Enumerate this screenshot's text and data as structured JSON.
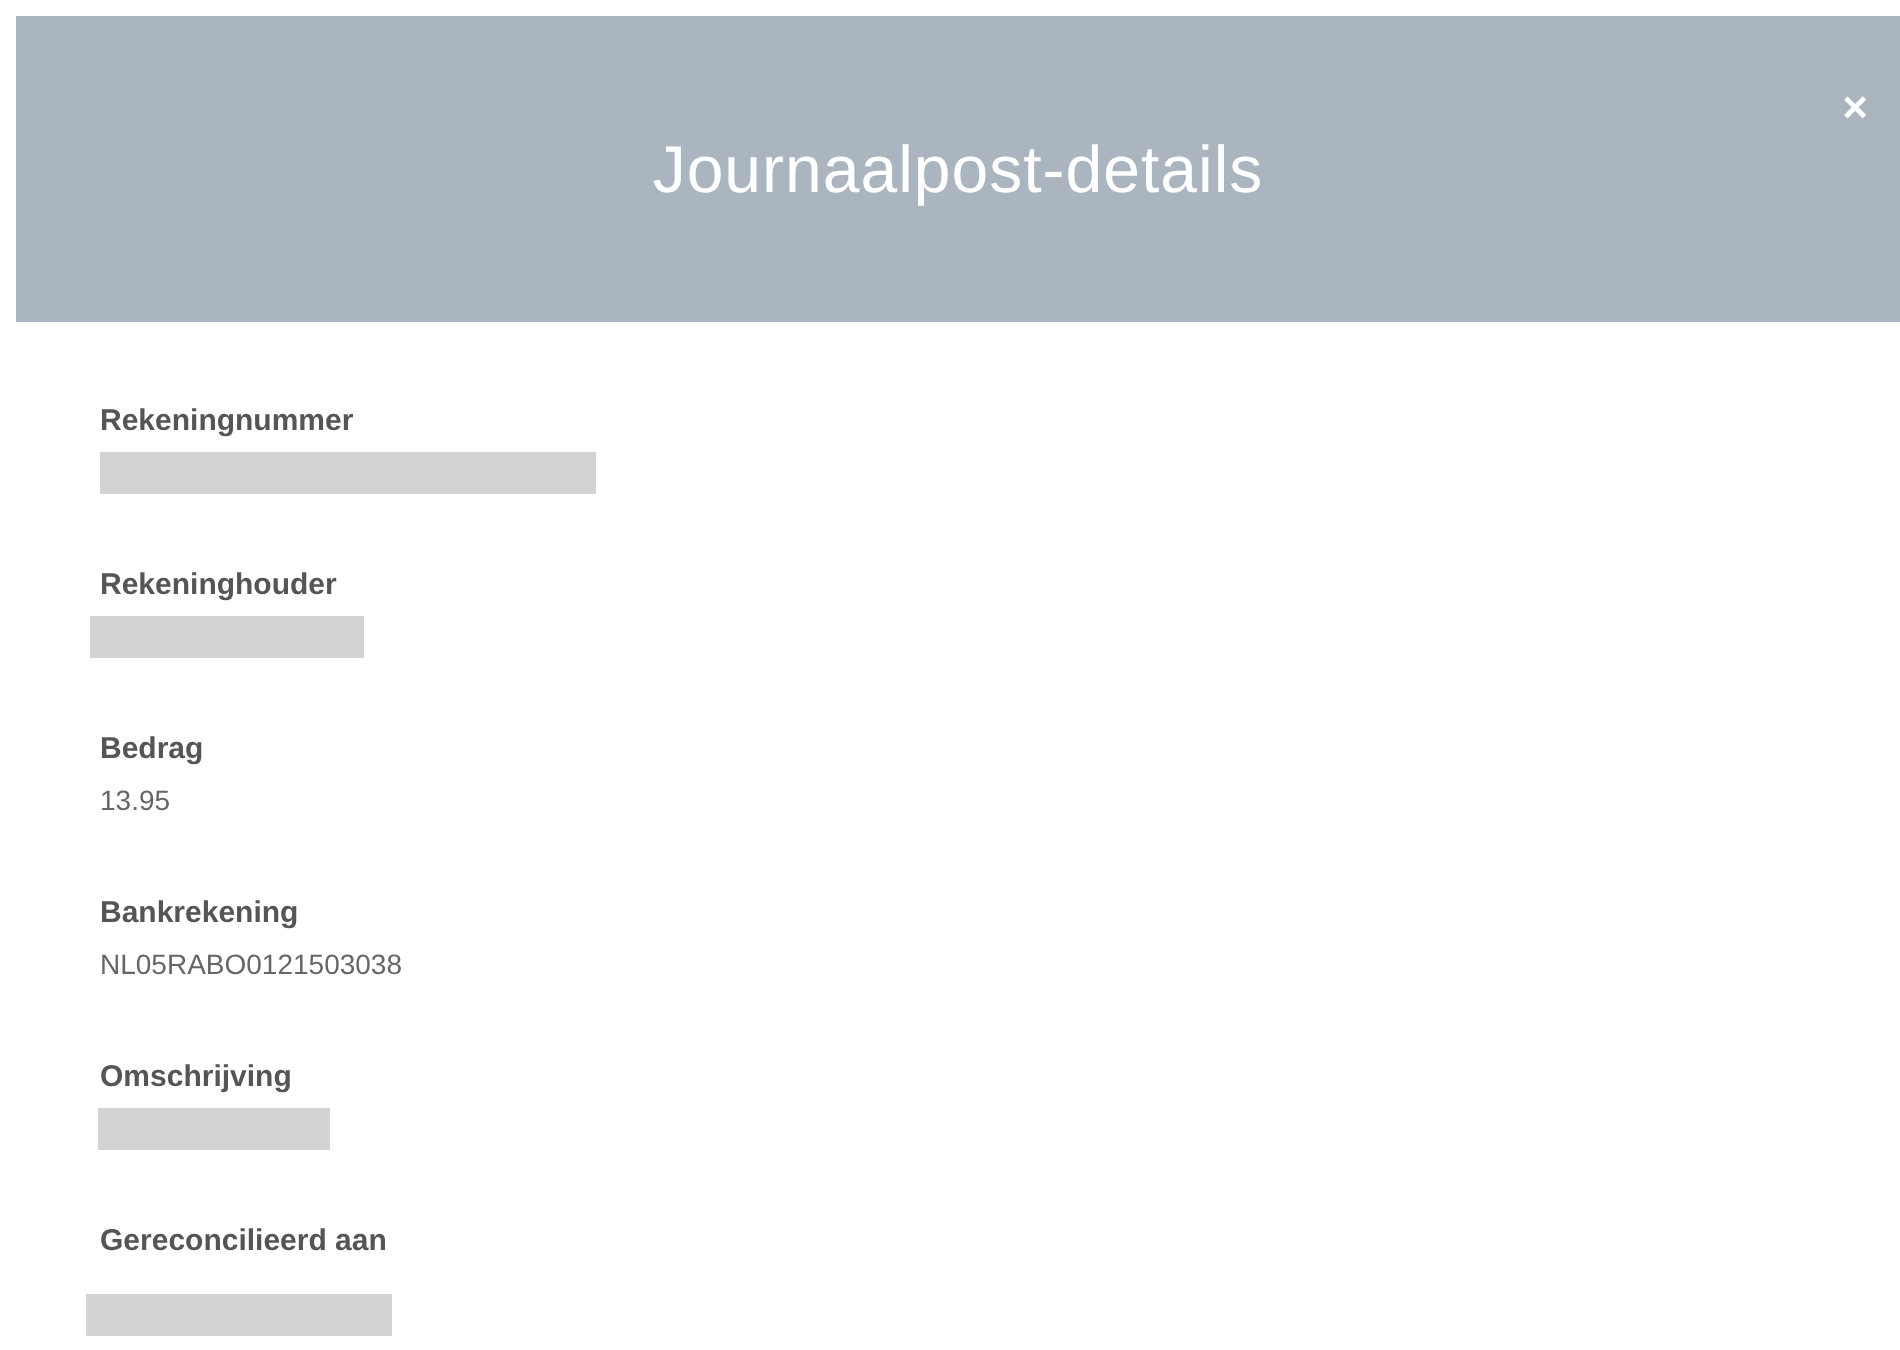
{
  "dialog": {
    "title": "Journaalpost-details",
    "close": "×"
  },
  "fields": [
    {
      "label": "Rekeningnummer",
      "redacted": true
    },
    {
      "label": "Rekeninghouder",
      "redacted": true
    },
    {
      "label": "Bedrag",
      "value": "13.95",
      "redacted": false
    },
    {
      "label": "Bankrekening",
      "value": "NL05RABO0121503038",
      "redacted": false
    },
    {
      "label": "Omschrijving",
      "redacted": true
    },
    {
      "label": "Gereconcilieerd aan",
      "redacted": true
    }
  ]
}
